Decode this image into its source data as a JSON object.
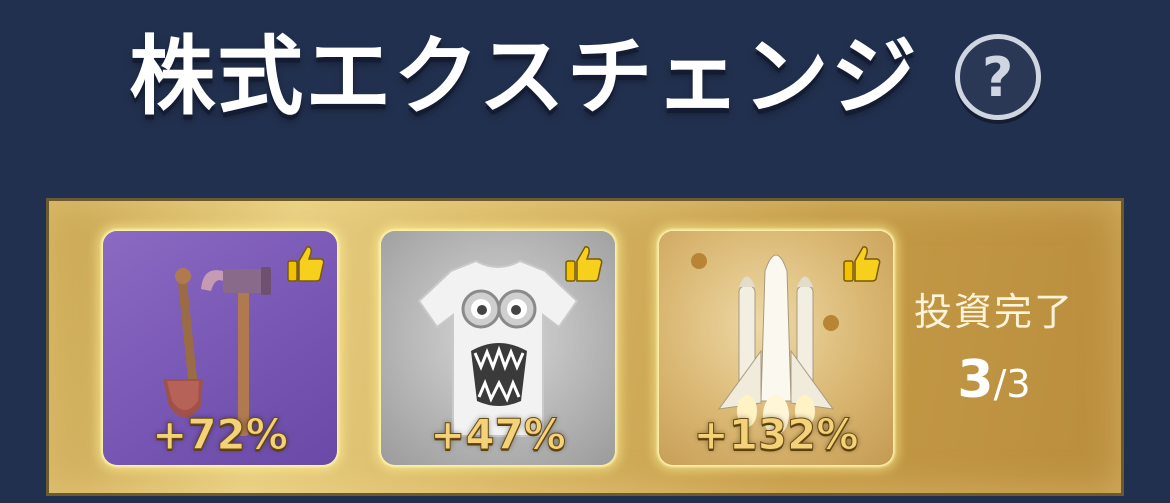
{
  "header": {
    "title": "株式エクスチェンジ",
    "help_symbol": "?"
  },
  "investments": [
    {
      "item": "tools (hammer, axe, shovel)",
      "icon": "tools-icon",
      "badge_icon": "thumbs-up-icon",
      "change": "+72%"
    },
    {
      "item": "t-shirt",
      "icon": "tshirt-icon",
      "badge_icon": "thumbs-up-icon",
      "change": "+47%"
    },
    {
      "item": "space shuttle",
      "icon": "rocket-icon",
      "badge_icon": "thumbs-up-icon",
      "change": "+132%"
    }
  ],
  "status": {
    "label": "投資完了",
    "done": "3",
    "separator": "/",
    "total": "3"
  },
  "colors": {
    "background": "#22304f",
    "panel_gold": "#d6b563",
    "percent_text": "#f3d27a"
  }
}
